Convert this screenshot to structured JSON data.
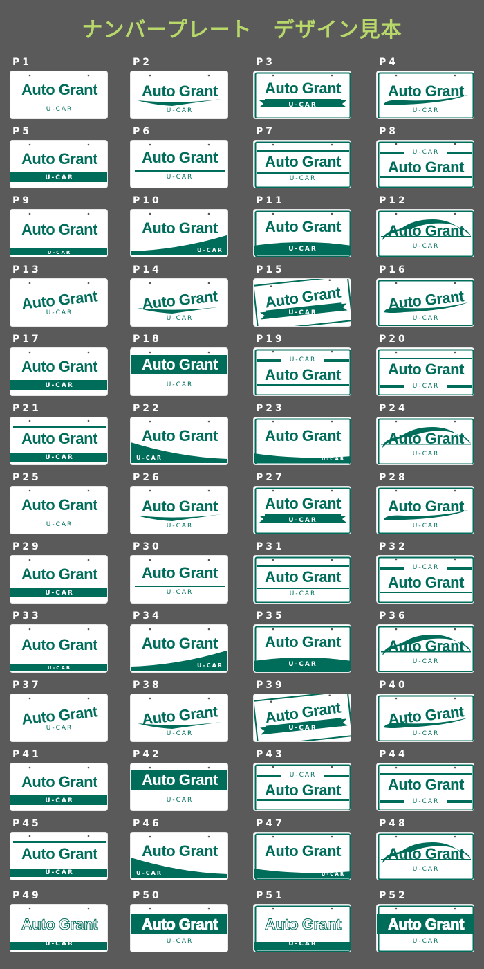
{
  "title": "ナンバープレート　デザイン見本",
  "colors": {
    "background": "#5a5a5a",
    "plate": "#ffffff",
    "accent": "#006d5b",
    "title": "#b8d96a"
  },
  "plate_text": {
    "name": "Auto Grant",
    "sub": "U-CAR"
  },
  "designs": [
    {
      "code": "P1",
      "style": "plain"
    },
    {
      "code": "P2",
      "style": "swoosh"
    },
    {
      "code": "P3",
      "style": "ribbon"
    },
    {
      "code": "P4",
      "style": "swash"
    },
    {
      "code": "P5",
      "style": "bar"
    },
    {
      "code": "P6",
      "style": "underline"
    },
    {
      "code": "P7",
      "style": "lines"
    },
    {
      "code": "P8",
      "style": "top-sub"
    },
    {
      "code": "P9",
      "style": "bottom-strip"
    },
    {
      "code": "P10",
      "style": "wave"
    },
    {
      "code": "P11",
      "style": "arc"
    },
    {
      "code": "P12",
      "style": "car"
    },
    {
      "code": "P13",
      "style": "plain-tilt"
    },
    {
      "code": "P14",
      "style": "swoosh-tilt"
    },
    {
      "code": "P15",
      "style": "ribbon-tilt"
    },
    {
      "code": "P16",
      "style": "swash-tilt"
    },
    {
      "code": "P17",
      "style": "bar"
    },
    {
      "code": "P18",
      "style": "band"
    },
    {
      "code": "P19",
      "style": "top-sub"
    },
    {
      "code": "P20",
      "style": "lines-sub"
    },
    {
      "code": "P21",
      "style": "top-line-bar"
    },
    {
      "code": "P22",
      "style": "wave-left"
    },
    {
      "code": "P23",
      "style": "arc-right"
    },
    {
      "code": "P24",
      "style": "car"
    },
    {
      "code": "P25",
      "style": "plain"
    },
    {
      "code": "P26",
      "style": "swoosh"
    },
    {
      "code": "P27",
      "style": "ribbon"
    },
    {
      "code": "P28",
      "style": "swash"
    },
    {
      "code": "P29",
      "style": "bar"
    },
    {
      "code": "P30",
      "style": "underline"
    },
    {
      "code": "P31",
      "style": "lines"
    },
    {
      "code": "P32",
      "style": "top-sub"
    },
    {
      "code": "P33",
      "style": "bottom-strip"
    },
    {
      "code": "P34",
      "style": "wave"
    },
    {
      "code": "P35",
      "style": "arc"
    },
    {
      "code": "P36",
      "style": "car"
    },
    {
      "code": "P37",
      "style": "plain-tilt"
    },
    {
      "code": "P38",
      "style": "swoosh-tilt"
    },
    {
      "code": "P39",
      "style": "ribbon-tilt"
    },
    {
      "code": "P40",
      "style": "swash-tilt"
    },
    {
      "code": "P41",
      "style": "bar"
    },
    {
      "code": "P42",
      "style": "band"
    },
    {
      "code": "P43",
      "style": "top-sub"
    },
    {
      "code": "P44",
      "style": "lines-sub"
    },
    {
      "code": "P45",
      "style": "top-line-bar"
    },
    {
      "code": "P46",
      "style": "wave-left"
    },
    {
      "code": "P47",
      "style": "arc-right"
    },
    {
      "code": "P48",
      "style": "car"
    },
    {
      "code": "P49",
      "style": "outline"
    },
    {
      "code": "P50",
      "style": "outline-band"
    },
    {
      "code": "P51",
      "style": "outline"
    },
    {
      "code": "P52",
      "style": "outline-band"
    }
  ]
}
